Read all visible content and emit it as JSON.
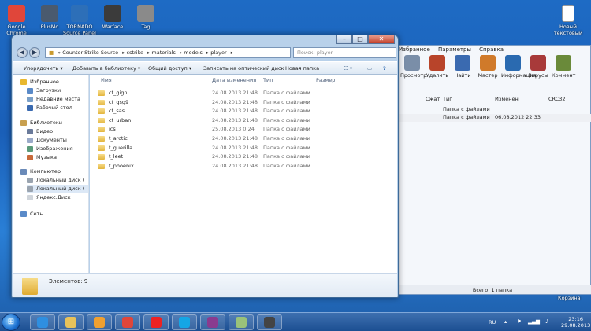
{
  "desktop": {
    "icons": [
      {
        "label": "Google Chrome",
        "color": "#e0463a"
      },
      {
        "label": "PlusMo",
        "color": "#4a5a6e"
      },
      {
        "label": "TORNADO Source Panel",
        "color": "#2d6fb8"
      },
      {
        "label": "Warface",
        "color": "#3b3b3b"
      },
      {
        "label": "Tag",
        "color": "#8a8a8a"
      }
    ],
    "right_icon": {
      "label": "Новый текстовый"
    },
    "trash_label": "Корзина"
  },
  "bg_app": {
    "menu": [
      "Избранное",
      "Параметры",
      "Справка"
    ],
    "tools": [
      "Просмотр",
      "Удалить",
      "Найти",
      "Мастер",
      "Информация",
      "Вирусы",
      "Коммент"
    ],
    "columns": [
      "Сжат",
      "Тип",
      "Изменен",
      "CRC32"
    ],
    "rows": [
      {
        "type": "Папка с файлами",
        "modified": ""
      },
      {
        "type": "Папка с файлами",
        "modified": "06.08.2012 22:33"
      }
    ],
    "status": "Всего: 1 папка"
  },
  "explorer": {
    "path": [
      "Counter-Strike Source",
      "cstrike",
      "materials",
      "models",
      "player"
    ],
    "search_placeholder": "Поиск: player",
    "commands": [
      "Упорядочить ▾",
      "Добавить в библиотеку ▾",
      "Общий доступ ▾",
      "Записать на оптический диск",
      "Новая папка"
    ],
    "nav": [
      {
        "label": "Избранное",
        "icon": "star-icon",
        "indent": 0,
        "sel": false
      },
      {
        "label": "Загрузки",
        "icon": "downloads-icon",
        "indent": 1,
        "sel": false
      },
      {
        "label": "Недавние места",
        "icon": "recent-icon",
        "indent": 1,
        "sel": false
      },
      {
        "label": "Рабочий стол",
        "icon": "desktop-icon",
        "indent": 1,
        "sel": false
      },
      {
        "label": "Библиотеки",
        "icon": "library-icon",
        "indent": 0,
        "sel": false
      },
      {
        "label": "Видео",
        "icon": "video-icon",
        "indent": 1,
        "sel": false
      },
      {
        "label": "Документы",
        "icon": "documents-icon",
        "indent": 1,
        "sel": false
      },
      {
        "label": "Изображения",
        "icon": "images-icon",
        "indent": 1,
        "sel": false
      },
      {
        "label": "Музыка",
        "icon": "music-icon",
        "indent": 1,
        "sel": false
      },
      {
        "label": "Компьютер",
        "icon": "computer-icon",
        "indent": 0,
        "sel": false
      },
      {
        "label": "Локальный диск (",
        "icon": "drive-icon",
        "indent": 1,
        "sel": false
      },
      {
        "label": "Локальный диск (",
        "icon": "drive-icon",
        "indent": 1,
        "sel": true
      },
      {
        "label": "Яндекс.Диск",
        "icon": "yandex-disk-icon",
        "indent": 1,
        "sel": false
      },
      {
        "label": "Сеть",
        "icon": "network-icon",
        "indent": 0,
        "sel": false
      }
    ],
    "columns": [
      "Имя",
      "Дата изменения",
      "Тип",
      "Размер"
    ],
    "files": [
      {
        "name": "ct_gign",
        "date": "24.08.2013 21:48",
        "type": "Папка с файлами"
      },
      {
        "name": "ct_gsg9",
        "date": "24.08.2013 21:48",
        "type": "Папка с файлами"
      },
      {
        "name": "ct_sas",
        "date": "24.08.2013 21:48",
        "type": "Папка с файлами"
      },
      {
        "name": "ct_urban",
        "date": "24.08.2013 21:48",
        "type": "Папка с файлами"
      },
      {
        "name": "ics",
        "date": "25.08.2013 0:24",
        "type": "Папка с файлами"
      },
      {
        "name": "t_arctic",
        "date": "24.08.2013 21:48",
        "type": "Папка с файлами"
      },
      {
        "name": "t_guerilla",
        "date": "24.08.2013 21:48",
        "type": "Папка с файлами"
      },
      {
        "name": "t_leet",
        "date": "24.08.2013 21:48",
        "type": "Папка с файлами"
      },
      {
        "name": "t_phoenix",
        "date": "24.08.2013 21:48",
        "type": "Папка с файлами"
      }
    ],
    "status": "Элементов: 9"
  },
  "taskbar": {
    "apps": [
      {
        "name": "ie",
        "color": "#2f8fe0"
      },
      {
        "name": "explorer",
        "color": "#e8c25a"
      },
      {
        "name": "media",
        "color": "#f0a030"
      },
      {
        "name": "chrome",
        "color": "#e0463a"
      },
      {
        "name": "yandex",
        "color": "#e22"
      },
      {
        "name": "skype",
        "color": "#15a6e5"
      },
      {
        "name": "winrar",
        "color": "#8a3b8f"
      },
      {
        "name": "folder2",
        "color": "#9ac27a"
      },
      {
        "name": "cs",
        "color": "#444"
      }
    ],
    "lang": "RU",
    "time": "23:16",
    "date": "29.08.2013"
  }
}
